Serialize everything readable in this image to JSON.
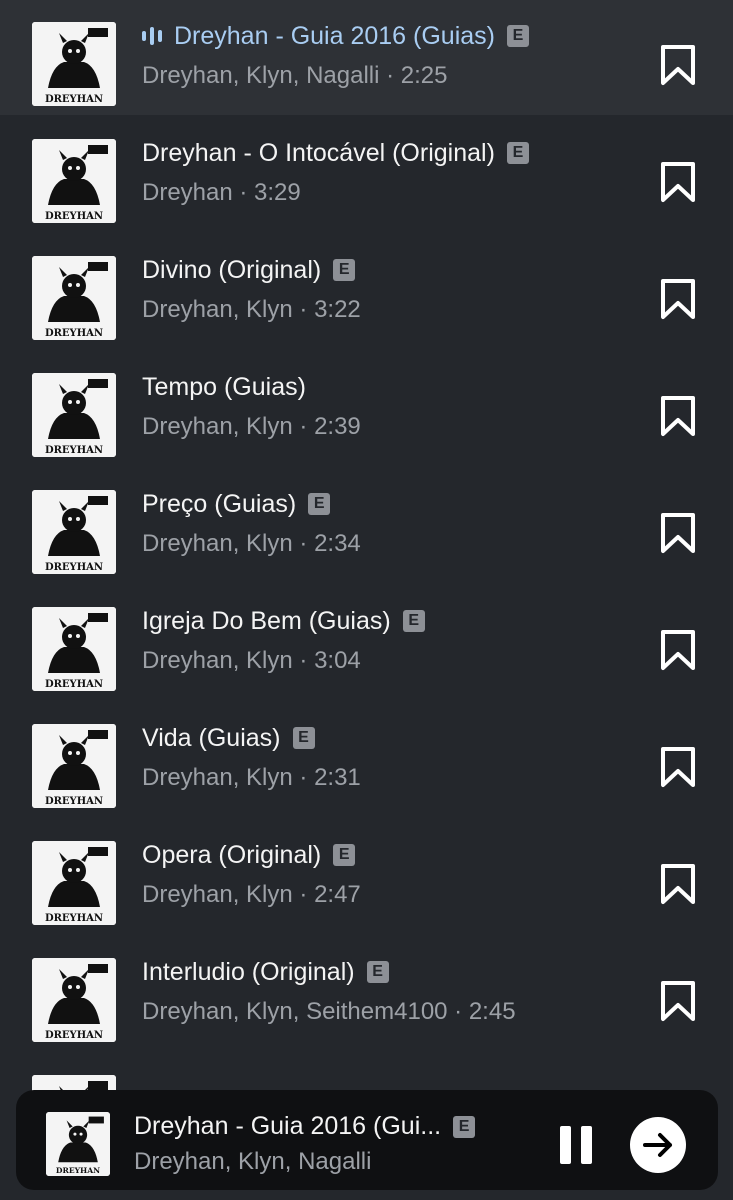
{
  "tracks": [
    {
      "title": "Dreyhan - Guia 2016 (Guias)",
      "subtitle": "Dreyhan, Klyn, Nagalli · 2:25",
      "explicit": true,
      "active": true
    },
    {
      "title": "Dreyhan - O Intocável (Original)",
      "subtitle": "Dreyhan · 3:29",
      "explicit": true,
      "active": false
    },
    {
      "title": "Divino (Original)",
      "subtitle": "Dreyhan, Klyn · 3:22",
      "explicit": true,
      "active": false
    },
    {
      "title": "Tempo (Guias)",
      "subtitle": "Dreyhan, Klyn · 2:39",
      "explicit": false,
      "active": false
    },
    {
      "title": "Preço (Guias)",
      "subtitle": "Dreyhan, Klyn · 2:34",
      "explicit": true,
      "active": false
    },
    {
      "title": "Igreja Do Bem (Guias)",
      "subtitle": "Dreyhan, Klyn · 3:04",
      "explicit": true,
      "active": false
    },
    {
      "title": "Vida (Guias)",
      "subtitle": "Dreyhan, Klyn · 2:31",
      "explicit": true,
      "active": false
    },
    {
      "title": "Opera (Original)",
      "subtitle": "Dreyhan, Klyn · 2:47",
      "explicit": true,
      "active": false
    },
    {
      "title": "Interludio (Original)",
      "subtitle": "Dreyhan, Klyn, Seithem4100 · 2:45",
      "explicit": true,
      "active": false
    }
  ],
  "explicit_badge": "E",
  "album_art_text": "DREYHAN",
  "now_playing": {
    "title": "Dreyhan - Guia 2016 (Gui...",
    "subtitle": "Dreyhan, Klyn, Nagalli",
    "explicit": true
  },
  "icons": {
    "bookmark": "bookmark-icon",
    "playing": "equalizer-icon",
    "pause": "pause-icon",
    "next": "arrow-right-icon"
  },
  "colors": {
    "background": "#24272c",
    "active_row": "#2e3136",
    "active_title": "#a9cdf2",
    "subtitle": "#9da1a7",
    "badge": "#8d9096",
    "player_bar": "#0f1012"
  }
}
